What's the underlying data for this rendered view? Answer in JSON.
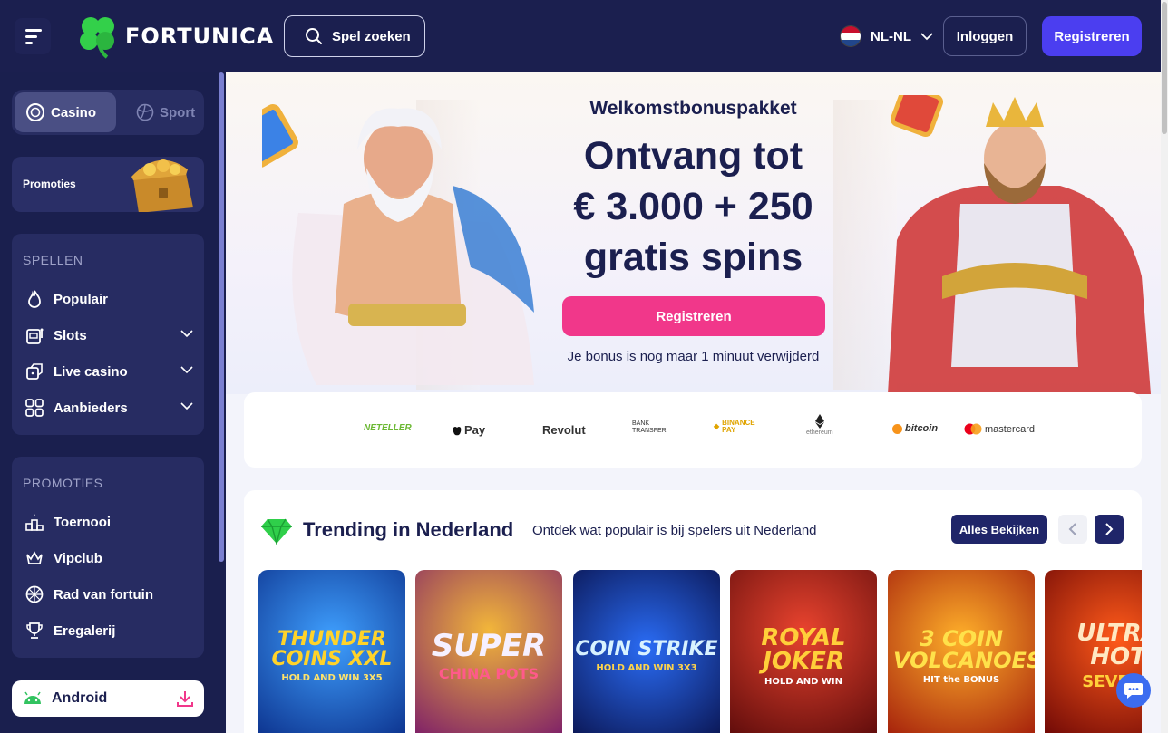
{
  "header": {
    "brand": "FORTUNICA",
    "search_label": "Spel zoeken",
    "language": "NL-NL",
    "login_label": "Inloggen",
    "register_label": "Registreren"
  },
  "sidebar": {
    "modes": [
      {
        "label": "Casino",
        "active": true
      },
      {
        "label": "Sport",
        "active": false
      }
    ],
    "promo_card_label": "Promoties",
    "games_section": {
      "title": "SPELLEN",
      "items": [
        {
          "label": "Populair",
          "icon": "flame-icon",
          "expandable": false
        },
        {
          "label": "Slots",
          "icon": "slot-machine-icon",
          "expandable": true
        },
        {
          "label": "Live casino",
          "icon": "dice-icon",
          "expandable": true
        },
        {
          "label": "Aanbieders",
          "icon": "grid-icon",
          "expandable": true
        }
      ]
    },
    "promotions_section": {
      "title": "PROMOTIES",
      "items": [
        {
          "label": "Toernooi",
          "icon": "podium-icon"
        },
        {
          "label": "Vipclub",
          "icon": "crown-icon"
        },
        {
          "label": "Rad van fortuin",
          "icon": "wheel-icon"
        },
        {
          "label": "Eregalerij",
          "icon": "trophy-icon"
        }
      ]
    },
    "android_label": "Android"
  },
  "hero": {
    "subtitle": "Welkomstbonuspakket",
    "title_lines": [
      "Ontvang tot",
      "€ 3.000 + 250",
      "gratis spins"
    ],
    "cta_label": "Registreren",
    "note": "Je bonus is nog maar 1 minuut verwijderd"
  },
  "payments": [
    "NETELLER",
    "Pay",
    "Revolut",
    "BANK TRANSFER",
    "BINANCE PAY",
    "ethereum",
    "bitcoin",
    "mastercard"
  ],
  "trending": {
    "title": "Trending in Nederland",
    "subtitle": "Ontdek wat populair is bij spelers uit Nederland",
    "view_all_label": "Alles Bekijken",
    "games": [
      {
        "name_line1": "THUNDER COINS XXL",
        "name_line2": "HOLD AND WIN 3X5"
      },
      {
        "name_line1": "SUPER",
        "name_line2": "CHINA POTS"
      },
      {
        "name_line1": "COIN STRIKE",
        "name_line2": "HOLD AND WIN 3X3"
      },
      {
        "name_line1": "ROYAL JOKER",
        "name_line2": "HOLD AND WIN"
      },
      {
        "name_line1": "3 COIN VOLCANOES",
        "name_line2": "HIT the BONUS"
      },
      {
        "name_line1": "ULTRA HOT",
        "name_line2": "SEVENS"
      }
    ]
  },
  "colors": {
    "header_bg": "#1b1f4f",
    "accent_purple": "#4b3ef0",
    "cta_pink": "#f1378a",
    "brand_green": "#33d04a"
  }
}
